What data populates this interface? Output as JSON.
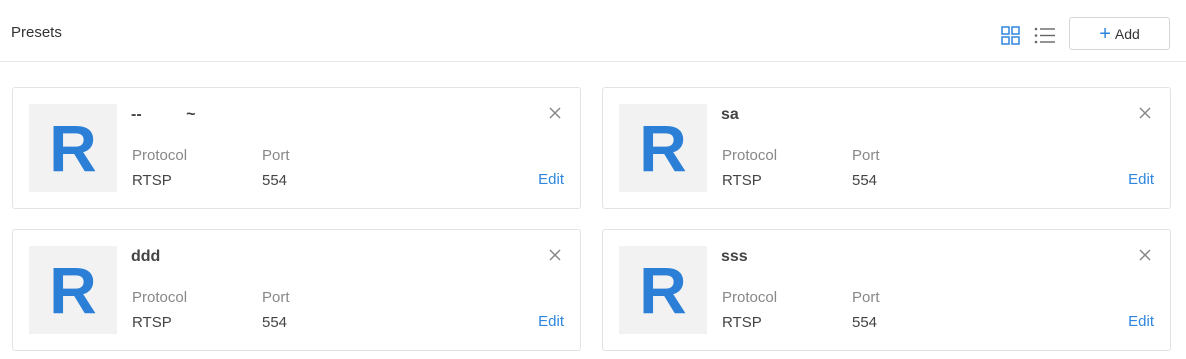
{
  "header": {
    "title": "Presets",
    "add_label": "Add",
    "accent": "#2e86de"
  },
  "labels": {
    "protocol": "Protocol",
    "port": "Port",
    "edit": "Edit"
  },
  "presets": [
    {
      "logo_letter": "R",
      "name": "--          ~",
      "protocol": "RTSP",
      "port": "554"
    },
    {
      "logo_letter": "R",
      "name": "sa",
      "protocol": "RTSP",
      "port": "554"
    },
    {
      "logo_letter": "R",
      "name": "ddd",
      "protocol": "RTSP",
      "port": "554"
    },
    {
      "logo_letter": "R",
      "name": "sss",
      "protocol": "RTSP",
      "port": "554"
    }
  ]
}
